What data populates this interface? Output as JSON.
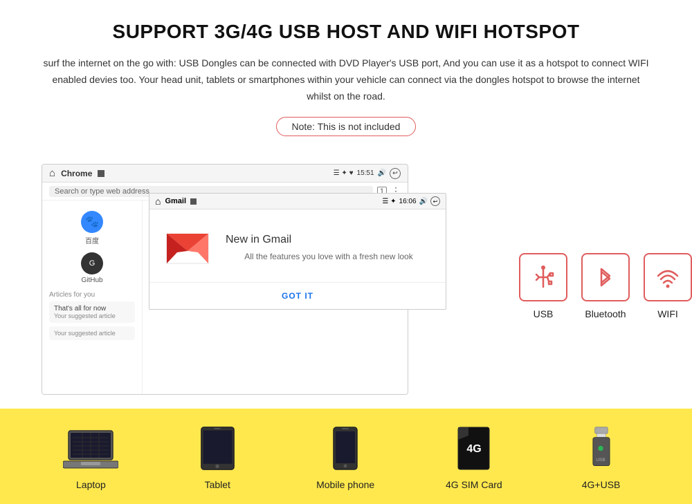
{
  "header": {
    "title": "SUPPORT 3G/4G USB HOST AND WIFI HOTSPOT",
    "description": "surf the internet on the go with: USB Dongles can be connected with DVD Player's USB port, And you can use it as a hotspot to connect WIFI enabled devies too. Your head unit, tablets or smartphones within your vehicle can connect via the dongles hotspot to browse the internet whilst on the road.",
    "note": "Note: This is not included"
  },
  "browser": {
    "app_name": "Chrome",
    "time": "15:51",
    "url_placeholder": "Search or type web address",
    "left_panel": {
      "app1_label": "百度",
      "app2_label": "GitHub",
      "section": "Articles for you",
      "card1_title": "That's all for now",
      "card1_sub": "Your suggested article",
      "card2_sub": "Your suggested article"
    }
  },
  "gmail_overlay": {
    "app_name": "Gmail",
    "time": "16:06",
    "title": "New in Gmail",
    "subtitle": "All the features you love with a fresh new look",
    "cta": "GOT IT"
  },
  "connectivity_icons": [
    {
      "id": "usb",
      "label": "USB"
    },
    {
      "id": "bluetooth",
      "label": "Bluetooth"
    },
    {
      "id": "wifi",
      "label": "WIFI"
    }
  ],
  "bottom_devices": [
    {
      "id": "laptop",
      "label": "Laptop"
    },
    {
      "id": "tablet",
      "label": "Tablet"
    },
    {
      "id": "mobile",
      "label": "Mobile phone"
    },
    {
      "id": "sim",
      "label": "4G SIM Card"
    },
    {
      "id": "usb_drive",
      "label": "4G+USB"
    }
  ]
}
